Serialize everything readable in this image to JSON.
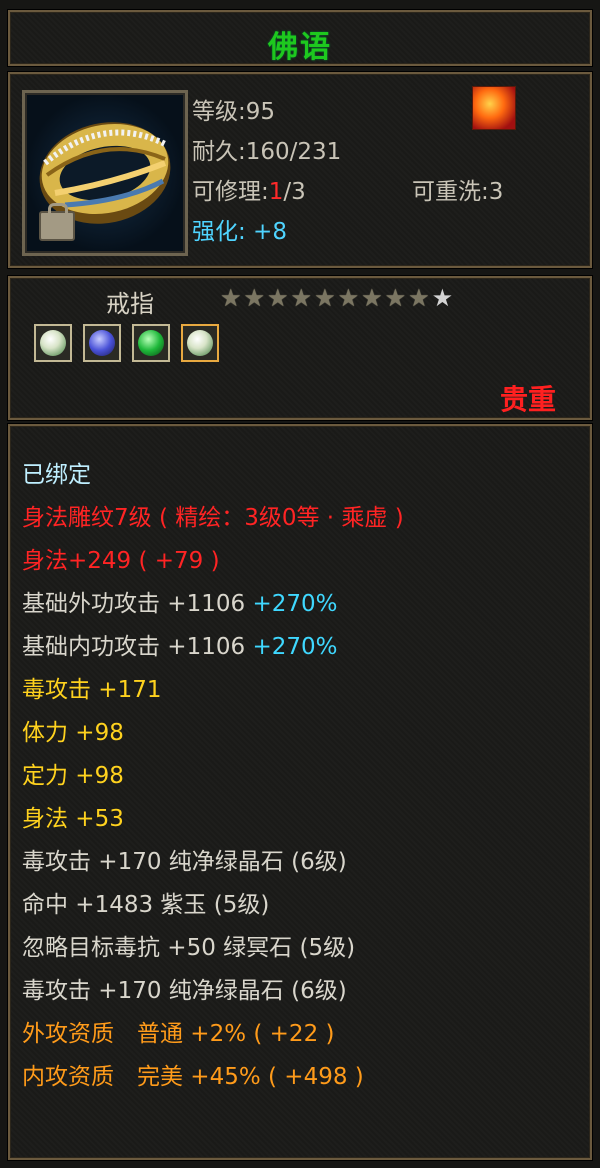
{
  "item": {
    "name": "佛语",
    "level_label": "等级:95",
    "durability_label": "耐久:160/231",
    "repair_prefix": "可修理:",
    "repair_current": "1",
    "repair_max": "/3",
    "rewash_label": "可重洗:3",
    "enhance_label": "强化: +8",
    "type": "戒指",
    "stars_filled": 9,
    "stars_total": 10,
    "rarity": "贵重"
  },
  "gems": [
    {
      "name": "white-gem",
      "color": "#d8e4c8"
    },
    {
      "name": "blue-gem",
      "color": "#4a52d8"
    },
    {
      "name": "green-gem",
      "color": "#1eb83a"
    },
    {
      "name": "white-gem",
      "color": "#d8e4c8"
    }
  ],
  "attributes": {
    "bound": "已绑定",
    "engrave": "身法雕纹7级 ( 精绘：3级0等 · 乘虚 )",
    "agility_total": "身法+249 ( +79 )",
    "base_outer_attack": "基础外功攻击 +1106",
    "base_outer_attack_pct": "+270%",
    "base_inner_attack": "基础内功攻击 +1106",
    "base_inner_attack_pct": "+270%",
    "poison_attack": "毒攻击 +171",
    "stamina": "体力 +98",
    "focus": "定力 +98",
    "agility": "身法 +53",
    "gem_line_1": "毒攻击 +170 纯净绿晶石 (6级)",
    "gem_line_2": "命中 +1483 紫玉 (5级)",
    "gem_line_3": "忽略目标毒抗 +50 绿冥石 (5级)",
    "gem_line_4": "毒攻击 +170 纯净绿晶石 (6级)",
    "outer_aptitude": "外攻资质　普通 +2% ( +22 )",
    "inner_aptitude": "内攻资质　完美 +45% ( +498 )"
  }
}
